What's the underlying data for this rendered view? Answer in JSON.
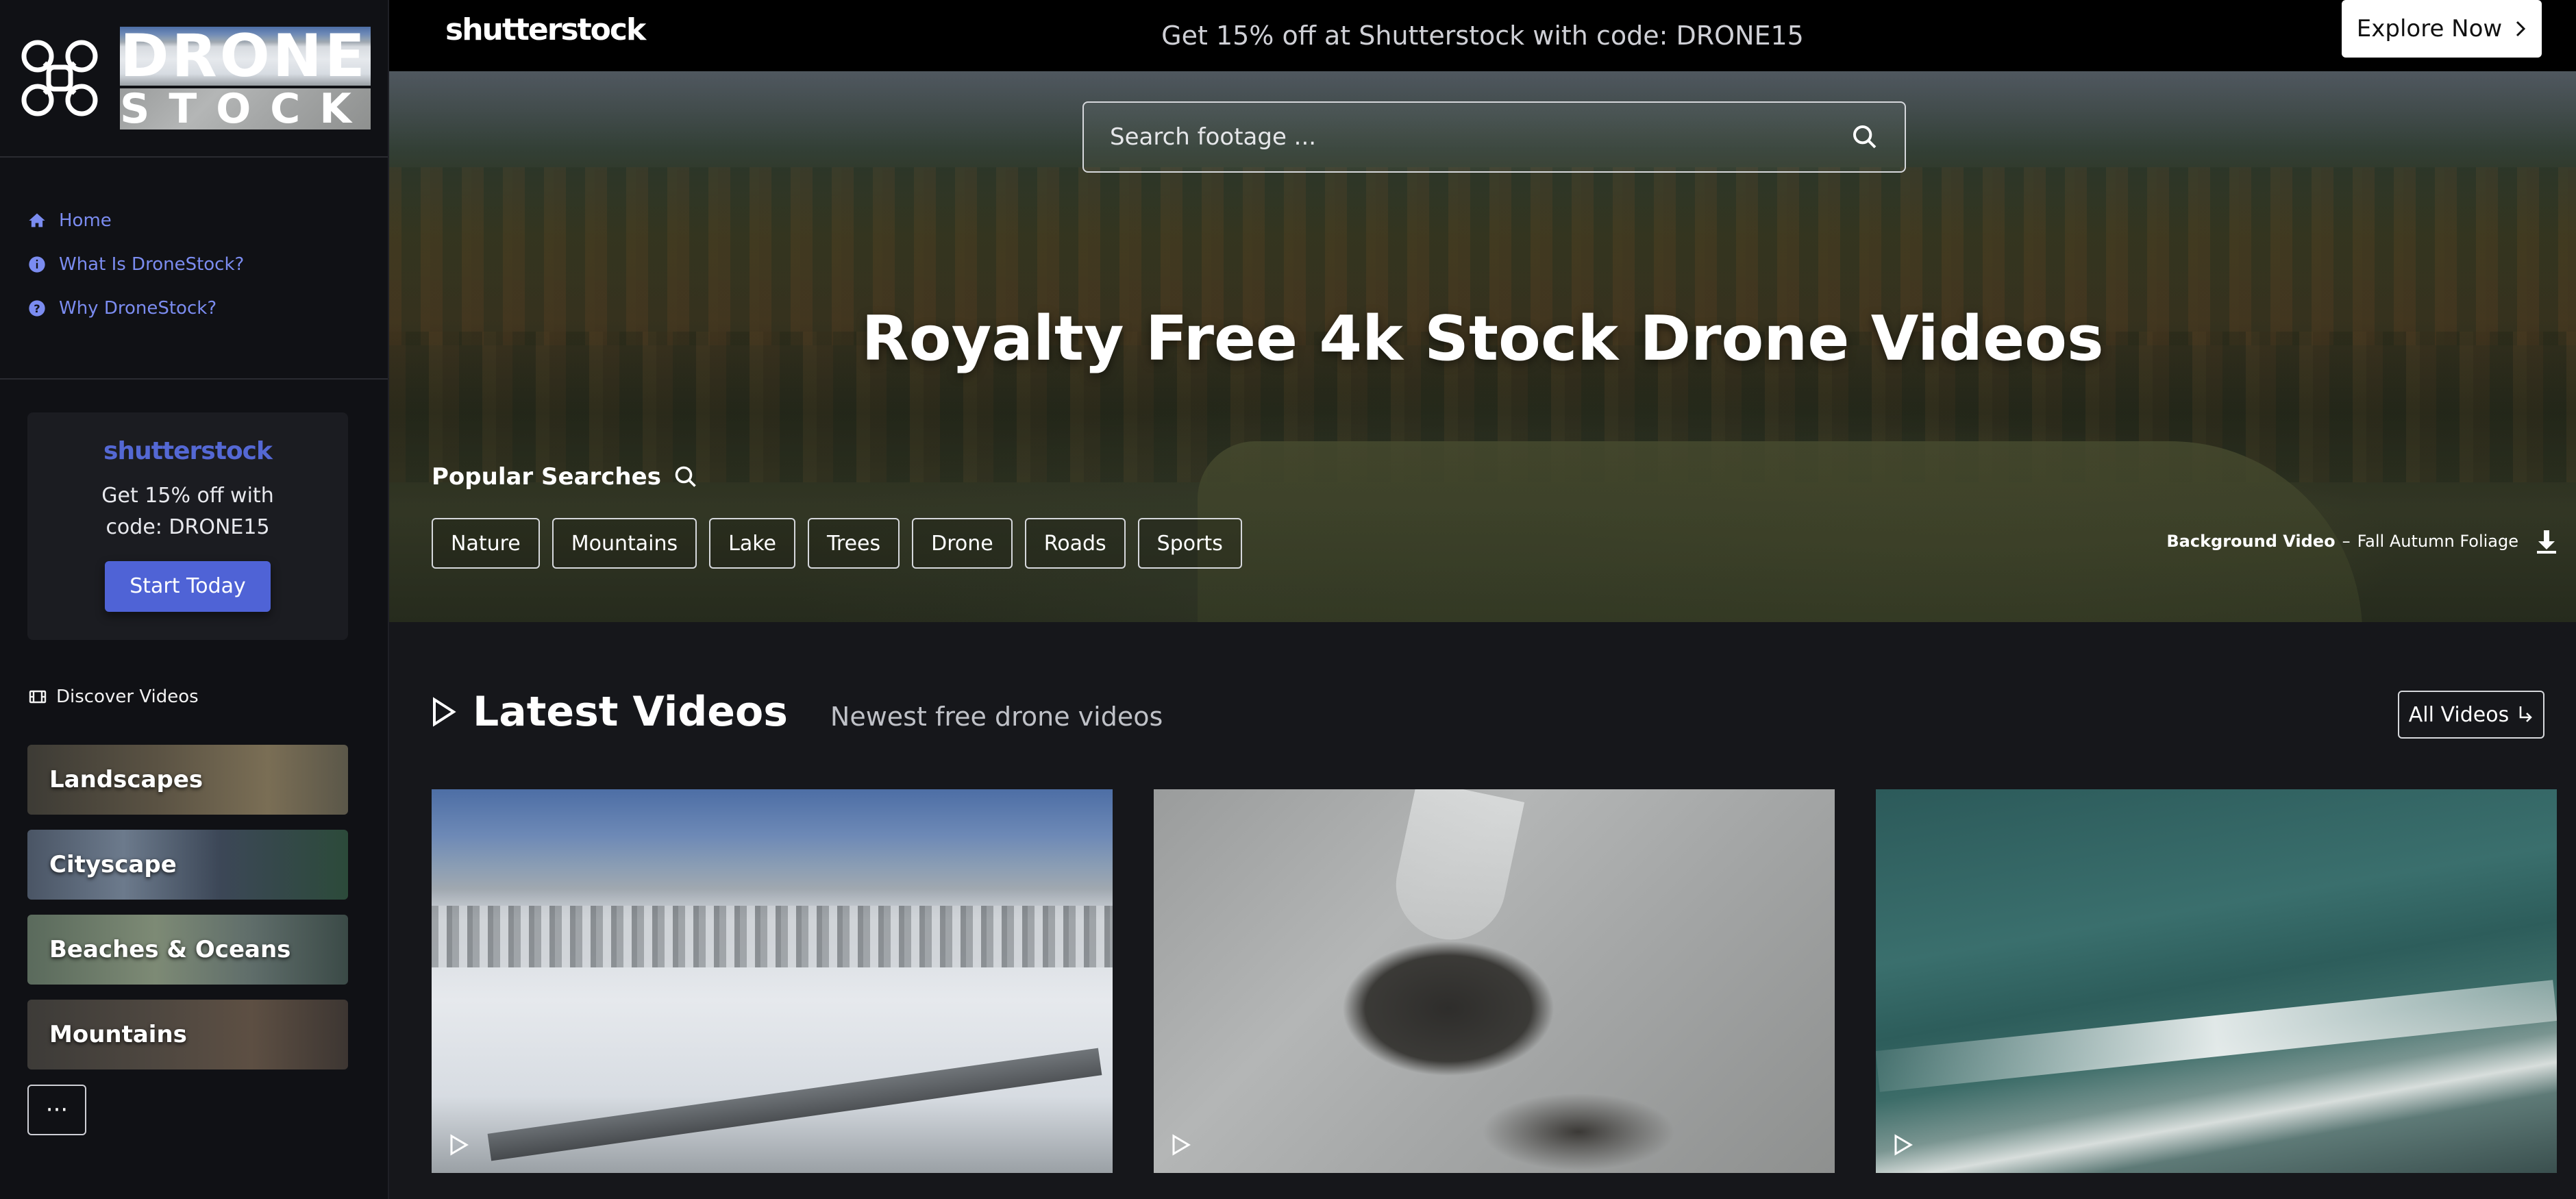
{
  "logo": {
    "line1": "DRONE",
    "line2": "STOCK"
  },
  "nav": [
    {
      "label": "Home",
      "icon": "home-icon"
    },
    {
      "label": "What Is DroneStock?",
      "icon": "info-icon"
    },
    {
      "label": "Why DroneStock?",
      "icon": "question-icon"
    }
  ],
  "sidebar_promo": {
    "brand": "shutterstock",
    "line1": "Get 15% off with",
    "line2": "code: DRONE15",
    "button": "Start Today"
  },
  "discover": {
    "label": "Discover Videos",
    "icon": "film-icon"
  },
  "categories": [
    "Landscapes",
    "Cityscape",
    "Beaches & Oceans",
    "Mountains"
  ],
  "more_label": "···",
  "topbar": {
    "brand": "shutterstock",
    "promo": "Get 15% off at Shutterstock with code: DRONE15",
    "button": "Explore Now"
  },
  "search": {
    "placeholder": "Search footage ...",
    "value": ""
  },
  "hero": {
    "title": "Royalty Free 4k Stock Drone Videos"
  },
  "popular": {
    "label": "Popular Searches",
    "chips": [
      "Nature",
      "Mountains",
      "Lake",
      "Trees",
      "Drone",
      "Roads",
      "Sports"
    ]
  },
  "background_video": {
    "label": "Background Video",
    "separator": " – ",
    "name": "Fall Autumn Foliage"
  },
  "latest": {
    "title": "Latest Videos",
    "subtitle": "Newest free drone videos",
    "all_button": "All Videos"
  },
  "colors": {
    "accent": "#4f63d6",
    "nav_link": "#7b8cf0",
    "background": "#16171b",
    "sidebar": "#101115"
  }
}
